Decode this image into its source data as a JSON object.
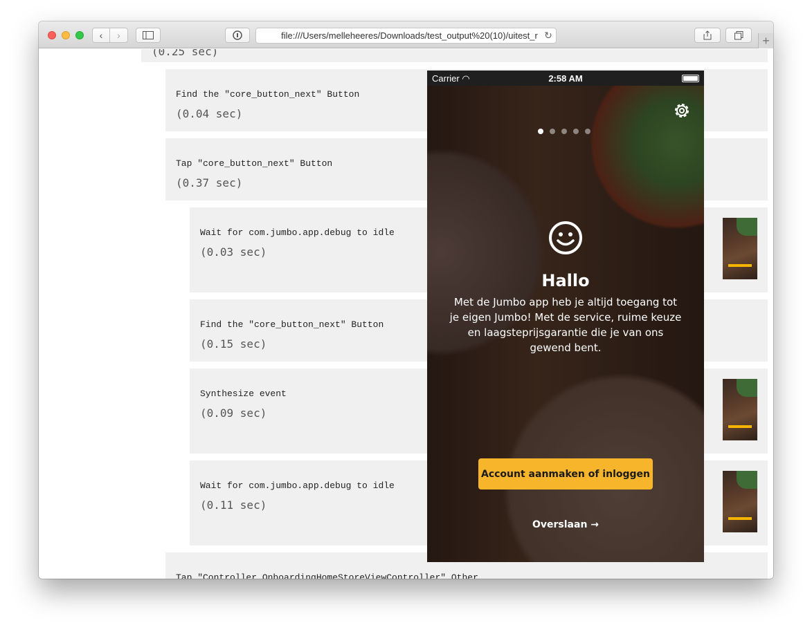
{
  "browser": {
    "url": "file:///Users/melleheeres/Downloads/test_output%20(10)/uitest_r",
    "reload_icon": "↻"
  },
  "steps": [
    {
      "name": "",
      "duration": "(0.25 sec)"
    },
    {
      "name": "Find the \"core_button_next\" Button",
      "duration": "(0.04 sec)"
    },
    {
      "name": "Tap \"core_button_next\" Button",
      "duration": "(0.37 sec)"
    },
    {
      "name": "Wait for com.jumbo.app.debug to idle",
      "duration": "(0.03 sec)"
    },
    {
      "name": "Find the \"core_button_next\" Button",
      "duration": "(0.15 sec)"
    },
    {
      "name": "Synthesize event",
      "duration": "(0.09 sec)"
    },
    {
      "name": "Wait for com.jumbo.app.debug to idle",
      "duration": "(0.11 sec)"
    },
    {
      "name": "Tap \"Controller_OnboardingHomeStoreViewController\" Other",
      "duration": ""
    }
  ],
  "phone": {
    "carrier": "Carrier",
    "time": "2:58 AM",
    "title": "Hallo",
    "intro": "Met de Jumbo app heb je altijd toegang tot je eigen Jumbo! Met de service, ruime keuze en laagsteprijsgarantie die je van ons gewend bent.",
    "cta": "Account aanmaken of inloggen",
    "skip": "Overslaan →",
    "page_indicator": {
      "count": 5,
      "active": 1
    }
  },
  "colors": {
    "cta": "#f7b52b",
    "step_bg": "#f0f0f0"
  }
}
